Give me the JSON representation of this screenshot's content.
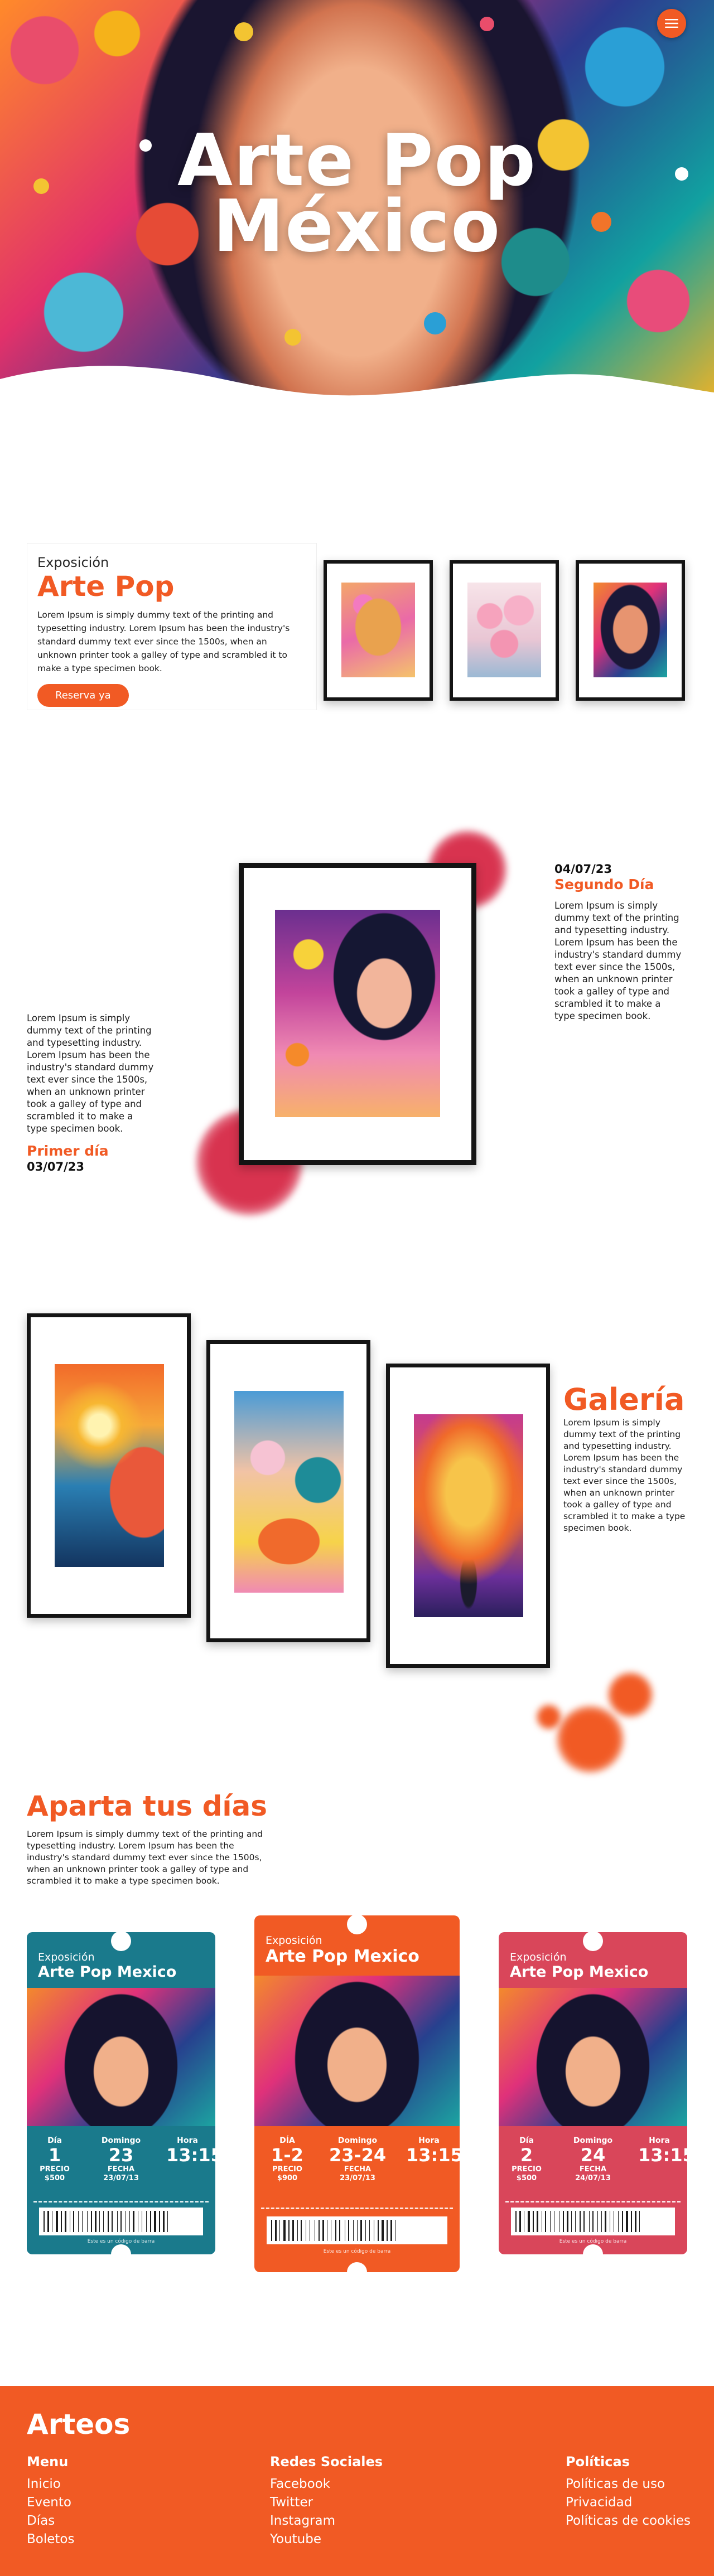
{
  "hero": {
    "title_line1": "Arte Pop",
    "title_line2": "México",
    "menu_icon": "hamburger-menu-icon"
  },
  "expo": {
    "eyebrow": "Exposición",
    "title": "Arte Pop",
    "body": "Lorem Ipsum is simply dummy text of the printing and typesetting industry. Lorem Ipsum has been the industry's standard dummy text ever since the 1500s, when an unknown printer took a galley of type and scrambled it to make a type specimen book.",
    "cta": "Reserva ya"
  },
  "days": {
    "day2": {
      "date": "04/07/23",
      "label": "Segundo Día",
      "body": "Lorem Ipsum is simply dummy text of the printing and typesetting industry. Lorem Ipsum has been the industry's standard dummy text ever since the 1500s, when an unknown printer took a galley of type and scrambled it to make a type specimen book."
    },
    "day1": {
      "body": "Lorem Ipsum is simply dummy text of the printing and typesetting industry. Lorem Ipsum has been the industry's standard dummy text ever since the 1500s, when an unknown printer took a galley of type and scrambled it to make a type specimen book.",
      "label": "Primer día",
      "date": "03/07/23"
    }
  },
  "gallery": {
    "title": "Galería",
    "body": "Lorem Ipsum is simply dummy text of the printing and typesetting industry. Lorem Ipsum has been the industry's standard dummy text ever since the 1500s, when an unknown printer took a galley of type and scrambled it to make a type specimen book."
  },
  "aparta": {
    "title": "Aparta tus días",
    "body": "Lorem Ipsum is simply dummy text of the printing and typesetting industry. Lorem Ipsum has been the industry's standard dummy text ever since the 1500s, when an unknown printer took a galley of type and scrambled it to make a type specimen book."
  },
  "tickets": [
    {
      "eyebrow": "Exposición",
      "title": "Arte Pop Mexico",
      "dia_label": "Día",
      "dia": "1",
      "domingo_label": "Domingo",
      "domingo": "23",
      "hora_label": "Hora",
      "hora": "13:15",
      "precio_label": "PRECIO",
      "precio": "$500",
      "fecha_label": "FECHA",
      "fecha": "23/07/13",
      "caption": "Este es un código de barra",
      "color": "#1a7a8c"
    },
    {
      "eyebrow": "Exposición",
      "title": "Arte Pop Mexico",
      "dia_label": "DÍA",
      "dia": "1-2",
      "domingo_label": "Domingo",
      "domingo": "23-24",
      "hora_label": "Hora",
      "hora": "13:15",
      "precio_label": "PRECIO",
      "precio": "$900",
      "fecha_label": "FECHA",
      "fecha": "23/07/13",
      "caption": "Este es un código de barra",
      "color": "#f15a24"
    },
    {
      "eyebrow": "Exposición",
      "title": "Arte Pop Mexico",
      "dia_label": "Día",
      "dia": "2",
      "domingo_label": "Domingo",
      "domingo": "24",
      "hora_label": "Hora",
      "hora": "13:15",
      "precio_label": "PRECIO",
      "precio": "$500",
      "fecha_label": "FECHA",
      "fecha": "24/07/13",
      "caption": "Este es un código de barra",
      "color": "#d9465a"
    }
  ],
  "footer": {
    "brand": "Arteos",
    "menu": {
      "title": "Menu",
      "items": [
        "Inicio",
        "Evento",
        "Días",
        "Boletos"
      ]
    },
    "social": {
      "title": "Redes Sociales",
      "items": [
        "Facebook",
        "Twitter",
        "Instagram",
        "Youtube"
      ]
    },
    "policies": {
      "title": "Políticas",
      "items": [
        "Políticas de uso",
        "Privacidad",
        "Políticas de cookies"
      ]
    }
  },
  "colors": {
    "accent": "#f15a24",
    "teal": "#1a7a8c",
    "red": "#d9465a"
  }
}
